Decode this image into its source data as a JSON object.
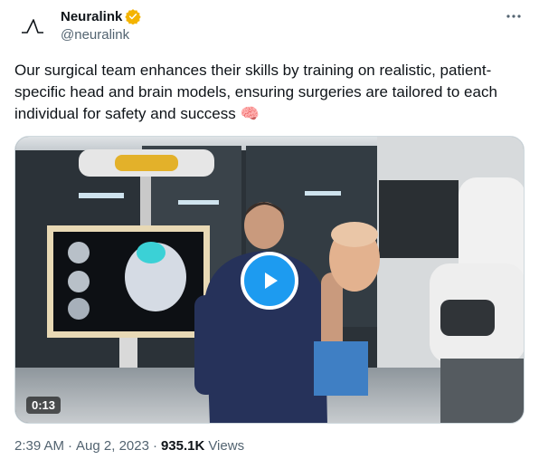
{
  "author": {
    "display_name": "Neuralink",
    "handle": "@neuralink",
    "verified": true,
    "verified_color": "#F4B400"
  },
  "tweet": {
    "text": "Our surgical team enhances their skills by training on realistic, patient-specific head and brain models, ensuring surgeries are tailored to each individual for safety and success 🧠"
  },
  "media": {
    "type": "video",
    "duration": "0:13",
    "play_icon": "play-icon"
  },
  "meta": {
    "time": "2:39 AM",
    "separator": "·",
    "date": "Aug 2, 2023",
    "views_count": "935.1K",
    "views_label": "Views"
  },
  "colors": {
    "accent": "#1d9bf0",
    "text_primary": "#0f1419",
    "text_secondary": "#536471"
  }
}
